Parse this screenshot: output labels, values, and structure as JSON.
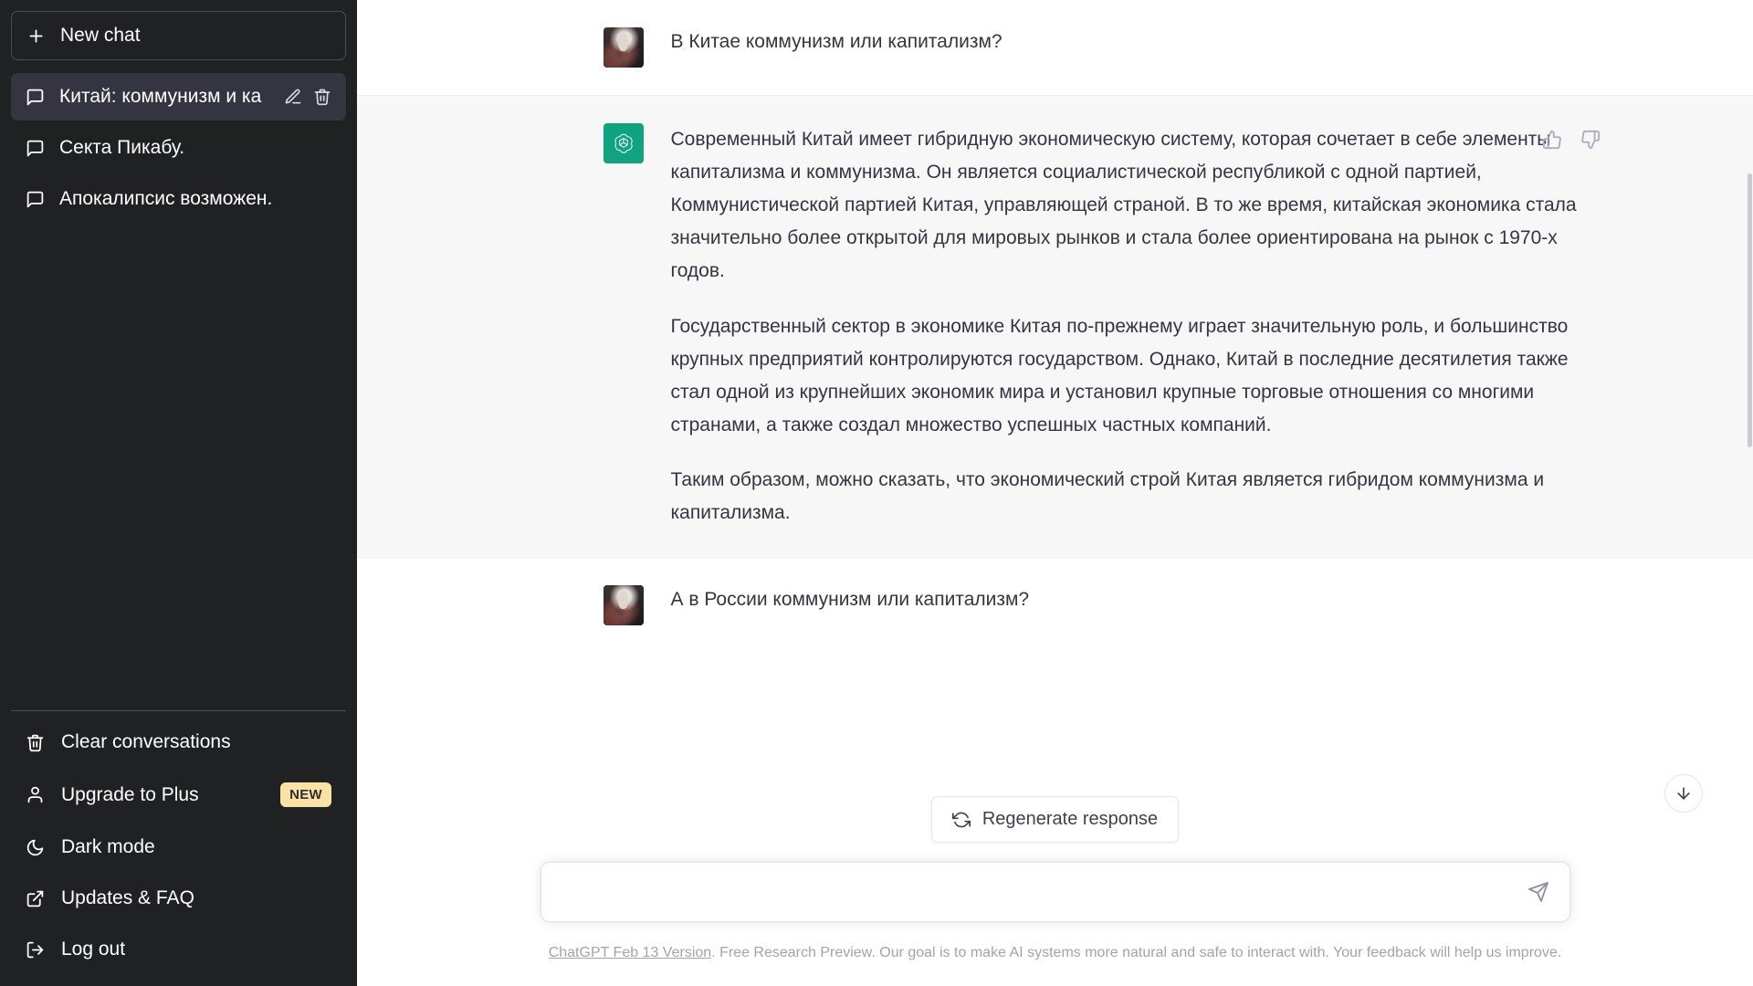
{
  "sidebar": {
    "new_chat": {
      "label": "New chat",
      "icon": "plus-icon"
    },
    "conversations": [
      {
        "label": "Китай: коммунизм и ка",
        "icon": "chat-bubble-icon",
        "active": true,
        "edit_icon": "pencil-icon",
        "delete_icon": "trash-icon"
      },
      {
        "label": "Секта Пикабу.",
        "icon": "chat-bubble-icon",
        "active": false
      },
      {
        "label": "Апокалипсис возможен.",
        "icon": "chat-bubble-icon",
        "active": false
      }
    ],
    "menu": [
      {
        "label": "Clear conversations",
        "icon": "trash-icon",
        "badge": ""
      },
      {
        "label": "Upgrade to Plus",
        "icon": "user-icon",
        "badge": "NEW"
      },
      {
        "label": "Dark mode",
        "icon": "moon-icon",
        "badge": ""
      },
      {
        "label": "Updates & FAQ",
        "icon": "external-link-icon",
        "badge": ""
      },
      {
        "label": "Log out",
        "icon": "logout-icon",
        "badge": ""
      }
    ]
  },
  "conversation": {
    "messages": [
      {
        "role": "user",
        "avatar": "user-avatar",
        "paragraphs": [
          "В Китае коммунизм или капитализм?"
        ]
      },
      {
        "role": "assistant",
        "avatar": "chatgpt-logo",
        "paragraphs": [
          "Современный Китай имеет гибридную экономическую систему, которая сочетает в себе элементы капитализма и коммунизма. Он является социалистической республикой с одной партией, Коммунистической партией Китая, управляющей страной. В то же время, китайская экономика стала значительно более открытой для мировых рынков и стала более ориентирована на рынок с 1970-х годов.",
          "Государственный сектор в экономике Китая по-прежнему играет значительную роль, и большинство крупных предприятий контролируются государством. Однако, Китай в последние десятилетия также стал одной из крупнейших экономик мира и установил крупные торговые отношения со многими странами, а также создал множество успешных частных компаний.",
          "Таким образом, можно сказать, что экономический строй Китая является гибридом коммунизма и капитализма."
        ],
        "feedback": {
          "like_icon": "thumbs-up-icon",
          "dislike_icon": "thumbs-down-icon"
        }
      },
      {
        "role": "user",
        "avatar": "user-avatar",
        "paragraphs": [
          "А в России коммунизм или капитализм?"
        ]
      }
    ]
  },
  "composer": {
    "regenerate_label": "Regenerate response",
    "regenerate_icon": "refresh-icon",
    "scroll_icon": "arrow-down-icon",
    "input_value": "",
    "input_placeholder": "",
    "send_icon": "send-icon"
  },
  "footer": {
    "link_text": "ChatGPT Feb 13 Version",
    "rest_text": ". Free Research Preview. Our goal is to make AI systems more natural and safe to interact with. Your feedback will help us improve."
  },
  "colors": {
    "sidebar_bg": "#202123",
    "active_item": "#343541",
    "assistant_bg": "#f7f7f8",
    "brand_green": "#10a37f",
    "badge_bg": "#f9e2a4"
  }
}
